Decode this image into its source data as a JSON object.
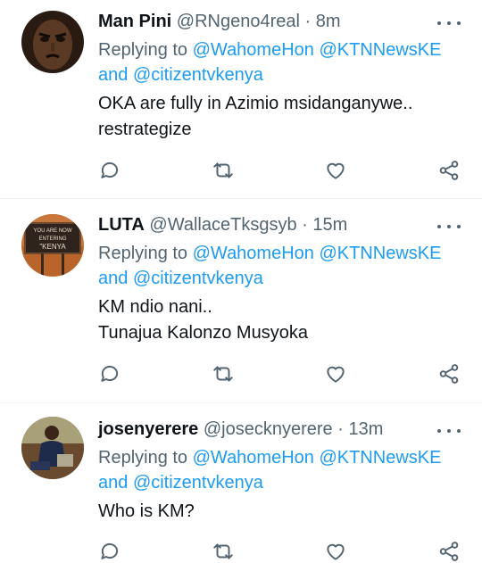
{
  "tweets": [
    {
      "name": "Man Pini",
      "handle": "@RNgeno4real",
      "separator": "·",
      "time": "8m",
      "reply_prefix": "Replying to",
      "mention1": "@WahomeHon",
      "mention2": "@KTNNewsKE",
      "reply_and": "and",
      "mention3": "@citizentvkenya",
      "lines": [
        "OKA are fully in Azimio msidanganywe..",
        "restrategize"
      ]
    },
    {
      "name": "LUTA",
      "handle": "@WallaceTksgsyb",
      "separator": "·",
      "time": "15m",
      "reply_prefix": "Replying to",
      "mention1": "@WahomeHon",
      "mention2": "@KTNNewsKE",
      "reply_and": "and",
      "mention3": "@citizentvkenya",
      "lines": [
        "KM ndio nani..",
        "Tunajua Kalonzo Musyoka"
      ],
      "avatar_sign_lines": [
        "YOU ARE NOW",
        "ENTERING",
        "\"KENYA"
      ]
    },
    {
      "name": "josenyerere",
      "handle": "@josecknyerere",
      "separator": "·",
      "time": "13m",
      "reply_prefix": "Replying to",
      "mention1": "@WahomeHon",
      "mention2": "@KTNNewsKE",
      "reply_and": "and",
      "mention3": "@citizentvkenya",
      "lines": [
        "Who is KM?"
      ]
    }
  ],
  "icons": [
    "more-icon",
    "reply-icon",
    "retweet-icon",
    "like-icon",
    "share-icon"
  ],
  "colors": {
    "text": "#0f1419",
    "muted": "#536471",
    "link": "#1d9bf0",
    "divider": "#eff3f4"
  }
}
